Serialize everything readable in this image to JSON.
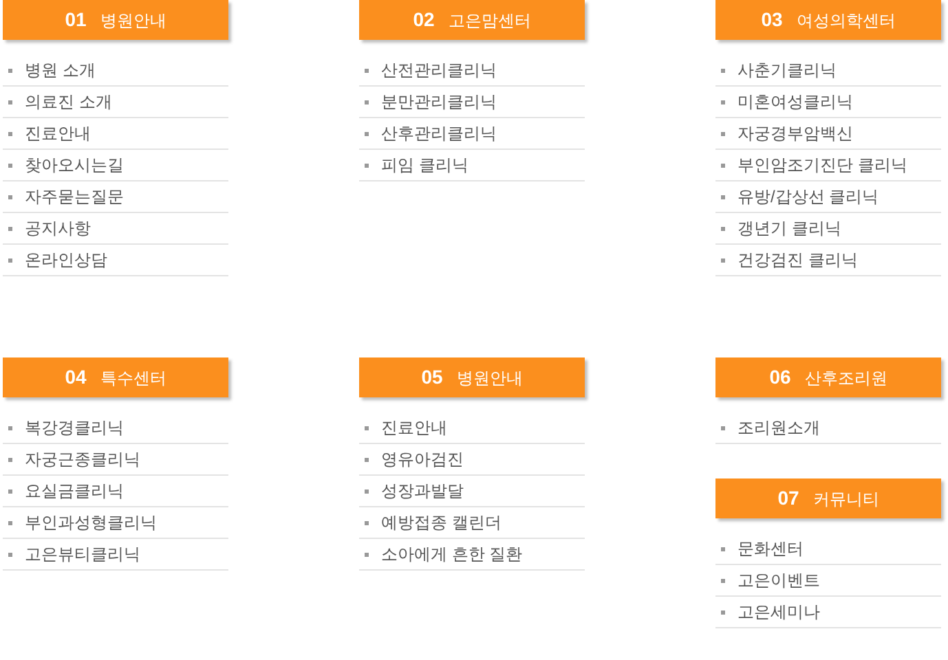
{
  "rows": [
    {
      "columns": [
        {
          "sections": [
            {
              "number": "01",
              "title": "병원안내",
              "items": [
                "병원 소개",
                "의료진 소개",
                "진료안내",
                "찾아오시는길",
                "자주묻는질문",
                "공지사항",
                "온라인상담"
              ]
            }
          ]
        },
        {
          "sections": [
            {
              "number": "02",
              "title": "고은맘센터",
              "items": [
                "산전관리클리닉",
                "분만관리클리닉",
                "산후관리클리닉",
                "피임 클리닉"
              ]
            }
          ]
        },
        {
          "sections": [
            {
              "number": "03",
              "title": "여성의학센터",
              "items": [
                "사춘기클리닉",
                "미혼여성클리닉",
                "자궁경부암백신",
                "부인암조기진단 클리닉",
                "유방/갑상선 클리닉",
                "갱년기 클리닉",
                "건강검진 클리닉"
              ]
            }
          ]
        }
      ]
    },
    {
      "columns": [
        {
          "sections": [
            {
              "number": "04",
              "title": "특수센터",
              "items": [
                "복강경클리닉",
                "자궁근종클리닉",
                "요실금클리닉",
                "부인과성형클리닉",
                "고은뷰티클리닉"
              ]
            }
          ]
        },
        {
          "sections": [
            {
              "number": "05",
              "title": "병원안내",
              "items": [
                "진료안내",
                "영유아검진",
                "성장과발달",
                "예방접종 캘린더",
                "소아에게 흔한 질환"
              ]
            }
          ]
        },
        {
          "sections": [
            {
              "number": "06",
              "title": "산후조리원",
              "items": [
                "조리원소개"
              ]
            },
            {
              "number": "07",
              "title": "커뮤니티",
              "items": [
                "문화센터",
                "고은이벤트",
                "고은세미나"
              ]
            }
          ]
        }
      ]
    }
  ]
}
